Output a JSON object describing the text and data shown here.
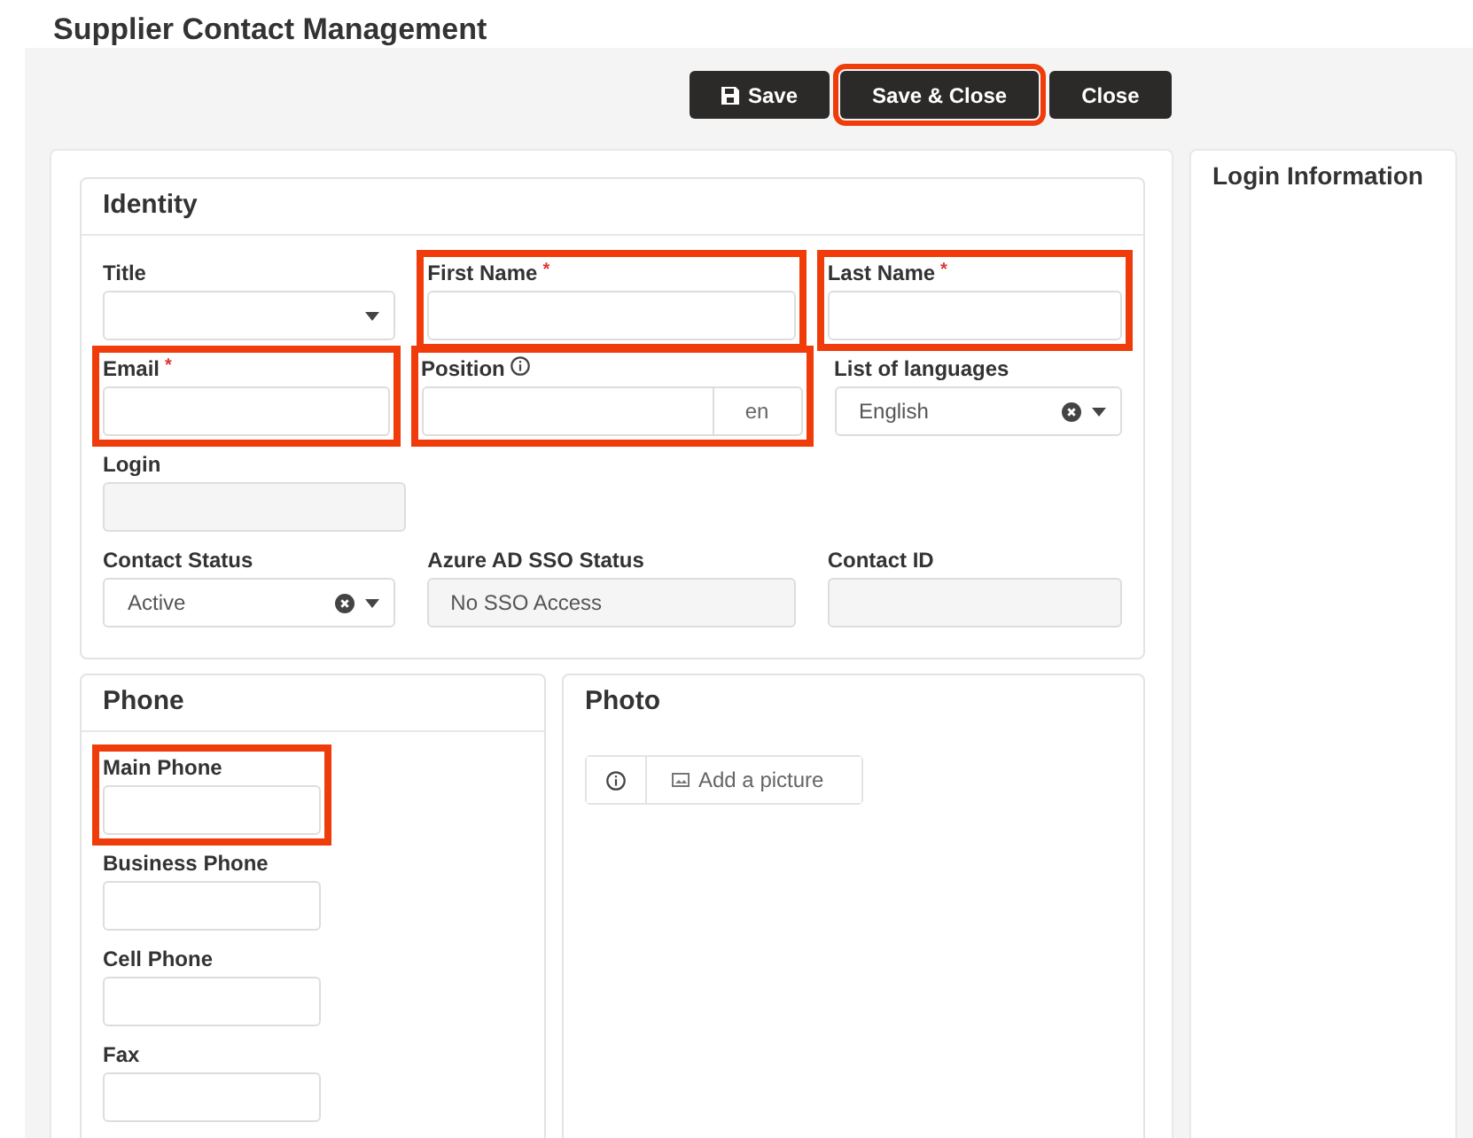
{
  "window": {
    "title": "Supplier Contact Management"
  },
  "buttons": [
    {
      "label": "Save",
      "kind": "icon",
      "highlighted": false
    },
    {
      "label": "Save & Close",
      "kind": "plain",
      "highlighted": true
    },
    {
      "label": "Close",
      "kind": "plain",
      "highlighted": false
    }
  ],
  "identity": {
    "title": "Identity",
    "rows": [
      [
        {
          "label": "Title",
          "kind": "select",
          "highlighted": false
        },
        {
          "label": "First Name",
          "kind": "text",
          "required_mark": "*",
          "highlighted": true
        },
        {
          "label": "Last Name",
          "kind": "text",
          "required_mark": "*",
          "highlighted": true
        }
      ],
      [
        {
          "label": "Email",
          "kind": "text",
          "required_mark": "*",
          "highlighted": true
        },
        {
          "label": "Position",
          "kind": "lang",
          "lang": "en",
          "info": true,
          "highlighted": true
        },
        {
          "label": "List of languages",
          "kind": "select",
          "value": "English",
          "clearable": true,
          "highlighted": false
        }
      ],
      [
        {
          "label": "Login",
          "kind": "readonly",
          "highlighted": false
        }
      ],
      [
        {
          "label": "Contact Status",
          "kind": "select",
          "value": "Active",
          "clearable": true,
          "highlighted": false
        },
        {
          "label": "Azure AD SSO Status",
          "kind": "readonly",
          "value": "No SSO Access",
          "highlighted": false
        },
        {
          "label": "Contact ID",
          "kind": "readonly",
          "highlighted": false
        }
      ]
    ]
  },
  "phone": {
    "title": "Phone",
    "fields": [
      {
        "label": "Main Phone",
        "highlighted": true
      },
      {
        "label": "Business Phone",
        "highlighted": false
      },
      {
        "label": "Cell Phone",
        "highlighted": false
      },
      {
        "label": "Fax",
        "highlighted": false
      }
    ]
  },
  "photo": {
    "title": "Photo",
    "add_label": "Add a picture"
  },
  "login_panel": {
    "title": "Login Information"
  }
}
